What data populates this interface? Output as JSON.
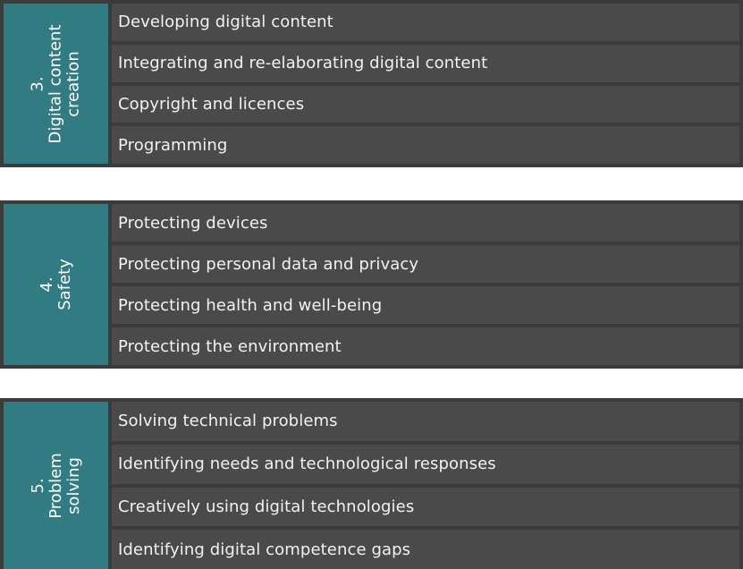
{
  "blocks": [
    {
      "number": "3.",
      "title_lines": [
        "Digital content",
        "creation"
      ],
      "items": [
        "Developing digital content",
        "Integrating and re-elaborating digital content",
        "Copyright and licences",
        "Programming"
      ]
    },
    {
      "number": "4.",
      "title_lines": [
        "Safety"
      ],
      "items": [
        "Protecting devices",
        "Protecting personal data and privacy",
        "Protecting health and well-being",
        "Protecting the environment"
      ]
    },
    {
      "number": "5.",
      "title_lines": [
        "Problem",
        "solving"
      ],
      "items": [
        "Solving technical problems",
        "Identifying needs and technological responses",
        "Creatively using digital technologies",
        "Identifying digital competence gaps"
      ]
    }
  ],
  "colors": {
    "accent": "#317b83",
    "row": "#4a4a4a",
    "border": "#3b3b3b"
  }
}
